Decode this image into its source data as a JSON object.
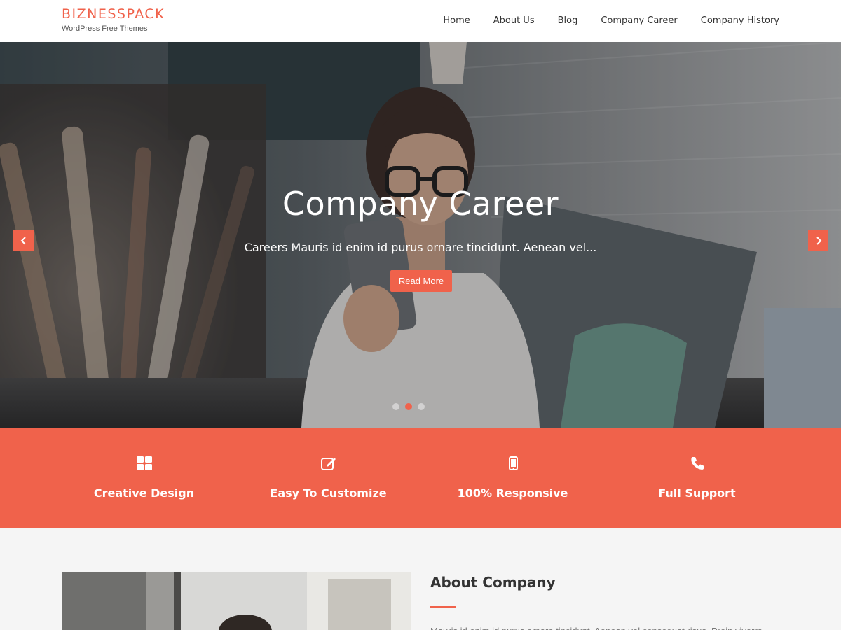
{
  "site": {
    "title": "BIZNESSPACK",
    "tagline": "WordPress Free Themes"
  },
  "nav": {
    "items": [
      {
        "label": "Home"
      },
      {
        "label": "About Us"
      },
      {
        "label": "Blog"
      },
      {
        "label": "Company Career"
      },
      {
        "label": "Company History"
      }
    ]
  },
  "hero": {
    "title": "Company Career",
    "text": "Careers Mauris id enim id purus ornare tincidunt. Aenean vel...",
    "button_label": "Read More",
    "prev_icon": "chevron-left-icon",
    "next_icon": "chevron-right-icon",
    "slide_count": 3,
    "active_slide": 2
  },
  "features": [
    {
      "label": "Creative Design",
      "icon": "grid-icon"
    },
    {
      "label": "Easy To Customize",
      "icon": "edit-icon"
    },
    {
      "label": "100% Responsive",
      "icon": "mobile-icon"
    },
    {
      "label": "Full Support",
      "icon": "phone-icon"
    }
  ],
  "about": {
    "title": "About Company",
    "text": "Mauris id enim id purus ornare tincidunt. Aenean vel consequat risus. Proin viverra"
  },
  "colors": {
    "accent": "#f0624b",
    "header_bg": "#ffffff",
    "section_bg": "#f5f5f5"
  }
}
